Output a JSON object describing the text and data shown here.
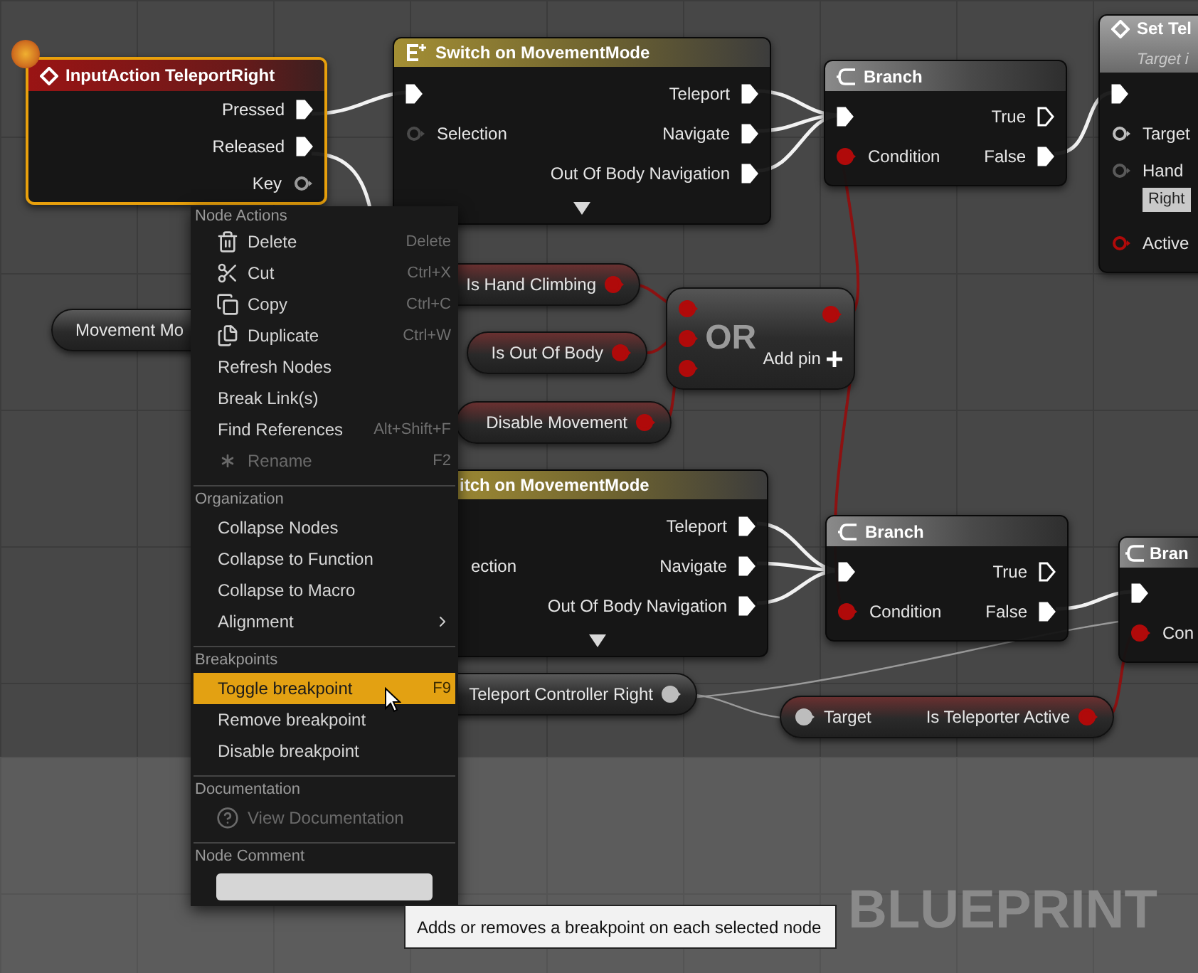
{
  "graph": {
    "nodes": [
      {
        "kind": "event",
        "title": "InputAction TeleportRight",
        "selected": true,
        "breakpoint": true,
        "outputs": [
          {
            "label": "Pressed",
            "kind": "exec",
            "connected": true
          },
          {
            "label": "Released",
            "kind": "exec",
            "connected": true
          },
          {
            "label": "Key",
            "kind": "struct",
            "connected": false
          }
        ]
      },
      {
        "kind": "switch",
        "title": "Switch on MovementMode",
        "selected": false,
        "breakpoint": false,
        "expander": true,
        "inputs": [
          {
            "kind": "exec",
            "connected": true
          },
          {
            "label": "Selection",
            "kind": "byte",
            "connected": false
          }
        ],
        "outputs": [
          {
            "label": "Teleport",
            "kind": "exec",
            "connected": true
          },
          {
            "label": "Navigate",
            "kind": "exec",
            "connected": true
          },
          {
            "label": "Out Of Body Navigation",
            "kind": "exec",
            "connected": true
          }
        ]
      },
      {
        "kind": "branch",
        "title": "Branch",
        "selected": false,
        "breakpoint": false,
        "inputs": [
          {
            "kind": "exec",
            "connected": true
          },
          {
            "label": "Condition",
            "kind": "bool",
            "connected": true
          }
        ],
        "outputs": [
          {
            "label": "True",
            "kind": "exec",
            "connected": false
          },
          {
            "label": "False",
            "kind": "exec",
            "connected": true
          }
        ]
      },
      {
        "kind": "function",
        "title": "Set Tel",
        "subtitle": "Target i",
        "selected": false,
        "breakpoint": false,
        "inputs": [
          {
            "kind": "exec",
            "connected": true
          },
          {
            "label": "Target",
            "kind": "object",
            "connected": false
          },
          {
            "label": "Hand",
            "kind": "enum",
            "connected": false,
            "value": "Right"
          },
          {
            "label": "Active",
            "kind": "bool",
            "connected": false
          }
        ]
      },
      {
        "kind": "pure",
        "title": "Movement Mo",
        "selected": false,
        "breakpoint": false
      },
      {
        "kind": "pure",
        "selected": false,
        "breakpoint": false,
        "outputs": [
          {
            "label": "Is Hand Climbing",
            "kind": "bool",
            "connected": true
          }
        ]
      },
      {
        "kind": "pure",
        "selected": false,
        "breakpoint": false,
        "outputs": [
          {
            "label": "Is Out Of Body",
            "kind": "bool",
            "connected": true
          }
        ]
      },
      {
        "kind": "or",
        "title": "OR",
        "add_pin": "Add pin",
        "selected": false,
        "breakpoint": false,
        "inputs": [
          {
            "kind": "bool",
            "connected": true
          },
          {
            "kind": "bool",
            "connected": true
          },
          {
            "kind": "bool",
            "connected": true
          }
        ],
        "outputs": [
          {
            "kind": "bool",
            "connected": true
          }
        ]
      },
      {
        "kind": "pure",
        "selected": false,
        "breakpoint": false,
        "outputs": [
          {
            "label": "Disable Movement",
            "kind": "bool",
            "connected": true
          }
        ]
      },
      {
        "kind": "switch",
        "title": "itch on MovementMode",
        "selected": false,
        "breakpoint": false,
        "expander": true,
        "inputs": [
          {
            "label": "ection"
          }
        ],
        "outputs": [
          {
            "label": "Teleport",
            "kind": "exec",
            "connected": true
          },
          {
            "label": "Navigate",
            "kind": "exec",
            "connected": true
          },
          {
            "label": "Out Of Body Navigation",
            "kind": "exec",
            "connected": true
          }
        ]
      },
      {
        "kind": "branch",
        "title": "Branch",
        "selected": false,
        "breakpoint": false,
        "inputs": [
          {
            "kind": "exec",
            "connected": true
          },
          {
            "label": "Condition",
            "kind": "bool",
            "connected": true
          }
        ],
        "outputs": [
          {
            "label": "True",
            "kind": "exec",
            "connected": false
          },
          {
            "label": "False",
            "kind": "exec",
            "connected": true
          }
        ]
      },
      {
        "kind": "pure",
        "selected": false,
        "breakpoint": false,
        "outputs": [
          {
            "label": "Teleport Controller Right",
            "kind": "object",
            "connected": true
          }
        ]
      },
      {
        "kind": "pure",
        "selected": false,
        "breakpoint": false,
        "inputs": [
          {
            "label": "Target",
            "kind": "object",
            "connected": true
          }
        ],
        "outputs": [
          {
            "label": "Is Teleporter Active",
            "kind": "bool",
            "connected": true
          }
        ]
      },
      {
        "kind": "branch",
        "title": "Bran",
        "selected": false,
        "breakpoint": false,
        "inputs": [
          {
            "kind": "exec",
            "connected": true
          },
          {
            "label": "Con",
            "kind": "bool",
            "connected": true
          }
        ]
      }
    ],
    "corner_label": "BLUEPRINT"
  },
  "context_menu": {
    "sections": [
      {
        "heading": "Node Actions",
        "items": [
          {
            "label": "Delete",
            "shortcut": "Delete",
            "disabled": false,
            "selected": false,
            "submenu": false
          },
          {
            "label": "Cut",
            "shortcut": "Ctrl+X",
            "disabled": false,
            "selected": false,
            "submenu": false
          },
          {
            "label": "Copy",
            "shortcut": "Ctrl+C",
            "disabled": false,
            "selected": false,
            "submenu": false
          },
          {
            "label": "Duplicate",
            "shortcut": "Ctrl+W",
            "disabled": false,
            "selected": false,
            "submenu": false
          },
          {
            "label": "Refresh Nodes",
            "disabled": false,
            "selected": false,
            "submenu": false
          },
          {
            "label": "Break Link(s)",
            "disabled": false,
            "selected": false,
            "submenu": false
          },
          {
            "label": "Find References",
            "shortcut": "Alt+Shift+F",
            "disabled": false,
            "selected": false,
            "submenu": false
          },
          {
            "label": "Rename",
            "shortcut": "F2",
            "disabled": true,
            "selected": false,
            "submenu": false
          }
        ]
      },
      {
        "heading": "Organization",
        "items": [
          {
            "label": "Collapse Nodes",
            "disabled": false,
            "selected": false,
            "submenu": false
          },
          {
            "label": "Collapse to Function",
            "disabled": false,
            "selected": false,
            "submenu": false
          },
          {
            "label": "Collapse to Macro",
            "disabled": false,
            "selected": false,
            "submenu": false
          },
          {
            "label": "Alignment",
            "disabled": false,
            "selected": false,
            "submenu": true
          }
        ]
      },
      {
        "heading": "Breakpoints",
        "items": [
          {
            "label": "Toggle breakpoint",
            "shortcut": "F9",
            "disabled": false,
            "selected": true,
            "submenu": false
          },
          {
            "label": "Remove breakpoint",
            "disabled": false,
            "selected": false,
            "submenu": false
          },
          {
            "label": "Disable breakpoint",
            "disabled": false,
            "selected": false,
            "submenu": false
          }
        ]
      },
      {
        "heading": "Documentation",
        "items": [
          {
            "label": "View Documentation",
            "disabled": true,
            "selected": false,
            "submenu": false
          }
        ]
      },
      {
        "heading": "Node Comment",
        "comment_field": true
      }
    ]
  },
  "tooltip": "Adds or removes a breakpoint on each selected node"
}
